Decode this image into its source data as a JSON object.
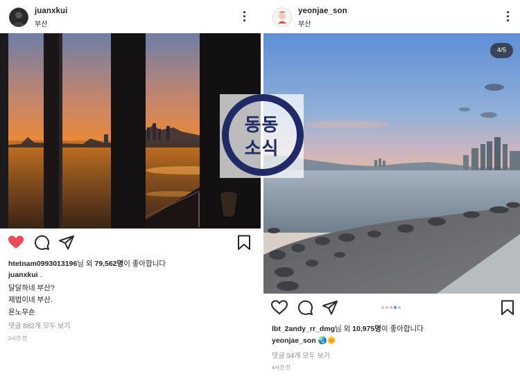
{
  "left_post": {
    "username": "juanxkui",
    "location": "부산",
    "likes_user": "htetnam0993013196",
    "likes_mid": "님 외 ",
    "likes_count": "79,562명",
    "likes_suffix": "이 좋아합니다",
    "caption_user": "juanxkui",
    "caption_user_suffix": " .",
    "caption_lines": [
      "달달하네 부산?",
      "제법이네 부산.",
      "욘노무숀"
    ],
    "comments_link": "댓글 882개 모두 보기",
    "time": "2시간 전",
    "liked": true
  },
  "right_post": {
    "username": "yeonjae_son",
    "location": "부산",
    "slide_counter": "4/5",
    "carousel": {
      "total": 5,
      "active_index": 3
    },
    "likes_user": "lbt_2andy_rr_dmg",
    "likes_mid": "님 외 ",
    "likes_count": "10,975명",
    "likes_suffix": "이 좋아합니다",
    "caption_user": "yeonjae_son",
    "caption_emoji": "🌏🌞",
    "comments_link": "댓글 94개 모두 보기",
    "time": "4시간 전",
    "liked": false
  },
  "watermark": {
    "line1": "동동",
    "line2": "소식"
  },
  "colors": {
    "like_red": "#ed4956",
    "carousel_active": "#3897f0",
    "watermark_navy": "#1f2a66"
  }
}
